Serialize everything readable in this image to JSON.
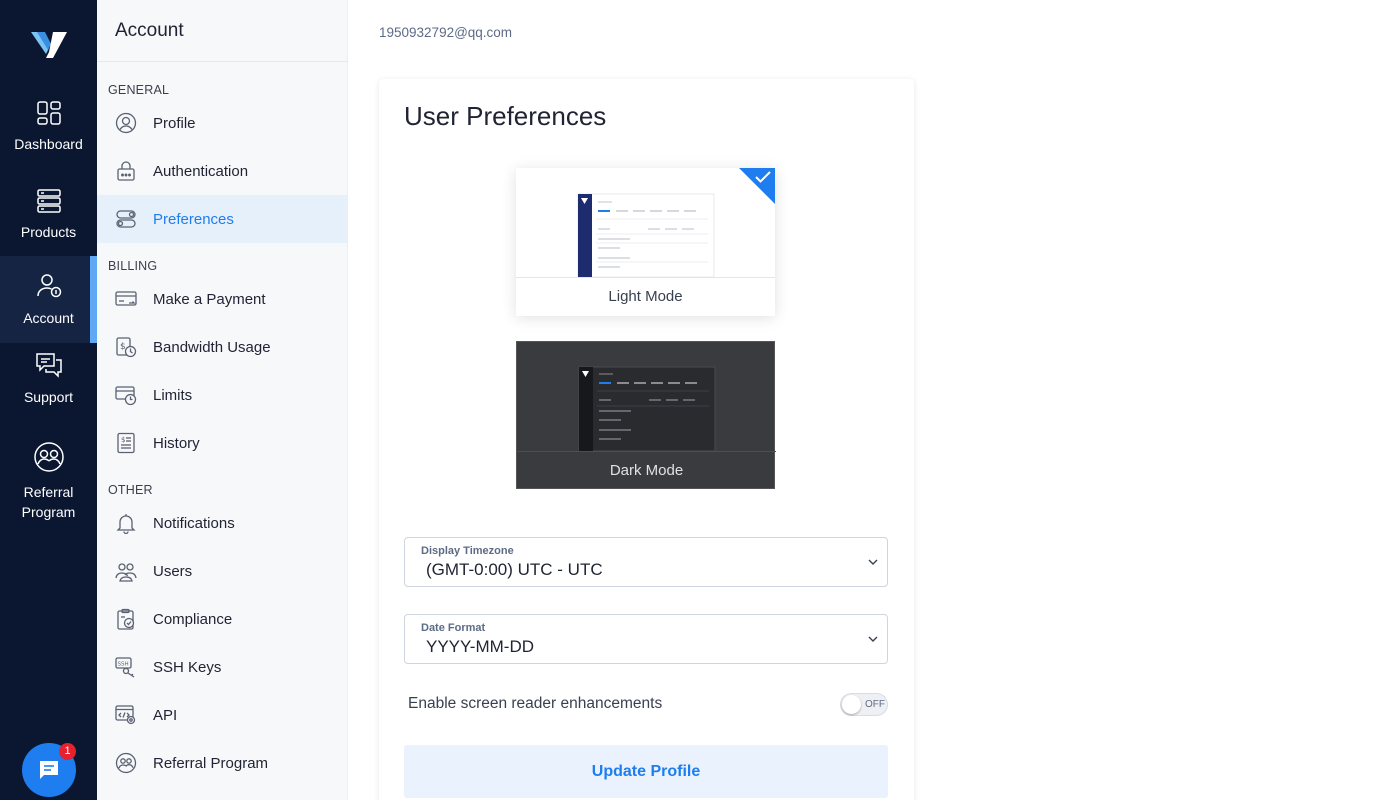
{
  "rail": {
    "items": [
      {
        "label": "Dashboard",
        "icon": "dashboard-icon"
      },
      {
        "label": "Products",
        "icon": "products-icon"
      },
      {
        "label": "Account",
        "icon": "account-icon",
        "active": true
      },
      {
        "label": "Support",
        "icon": "support-icon"
      },
      {
        "label": "Referral",
        "label2": "Program",
        "icon": "referral-icon"
      }
    ],
    "chat_badge": "1"
  },
  "sidebar": {
    "title": "Account",
    "sections": {
      "general": "GENERAL",
      "billing": "BILLING",
      "other": "OTHER"
    },
    "items": [
      {
        "label": "Profile",
        "icon": "profile-icon"
      },
      {
        "label": "Authentication",
        "icon": "lock-icon"
      },
      {
        "label": "Preferences",
        "icon": "toggles-icon",
        "active": true
      },
      {
        "label": "Make a Payment",
        "icon": "credit-card-icon"
      },
      {
        "label": "Bandwidth Usage",
        "icon": "bandwidth-icon"
      },
      {
        "label": "Limits",
        "icon": "limits-icon"
      },
      {
        "label": "History",
        "icon": "history-icon"
      },
      {
        "label": "Notifications",
        "icon": "bell-icon"
      },
      {
        "label": "Users",
        "icon": "users-icon"
      },
      {
        "label": "Compliance",
        "icon": "compliance-icon"
      },
      {
        "label": "SSH Keys",
        "icon": "ssh-key-icon"
      },
      {
        "label": "API",
        "icon": "api-icon"
      },
      {
        "label": "Referral Program",
        "icon": "referral-icon"
      }
    ]
  },
  "main": {
    "email": "1950932792@qq.com",
    "card_title": "User Preferences",
    "modes": {
      "light": "Light Mode",
      "dark": "Dark Mode",
      "selected": "light"
    },
    "timezone": {
      "label": "Display Timezone",
      "value": "(GMT-0:00) UTC - UTC"
    },
    "date_format": {
      "label": "Date Format",
      "value": "YYYY-MM-DD"
    },
    "screen_reader": {
      "label": "Enable screen reader enhancements",
      "state": "OFF"
    },
    "update_button": "Update Profile"
  },
  "colors": {
    "rail_bg": "#0b1731",
    "accent": "#1e7ef0",
    "active_item_bg": "#e6f0fb",
    "badge": "#e8212d"
  }
}
